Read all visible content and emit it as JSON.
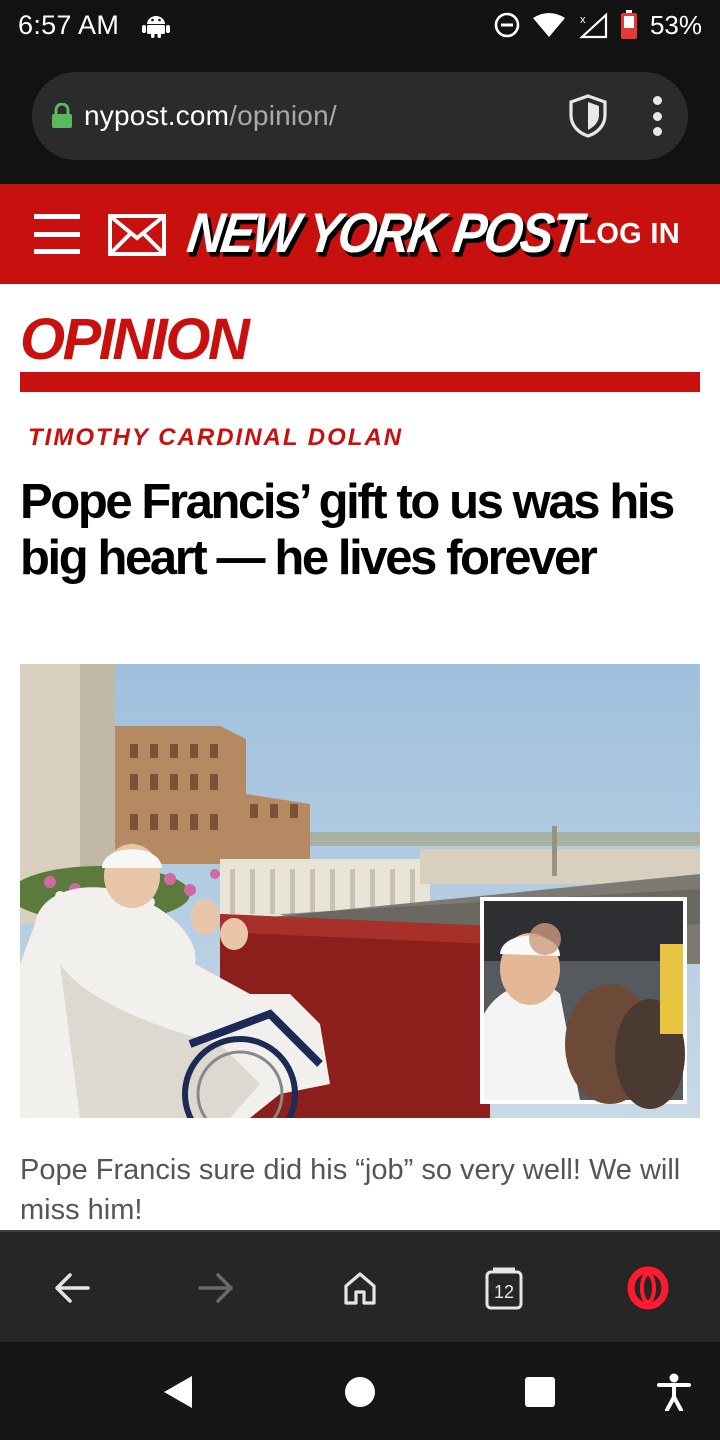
{
  "status_bar": {
    "time": "6:57 AM",
    "battery": "53%",
    "icons": [
      "android-icon",
      "do-not-disturb-icon",
      "wifi-icon",
      "signal-icon",
      "battery-icon"
    ]
  },
  "browser": {
    "url_domain": "nypost.com",
    "url_path": "/opinion/",
    "tab_count": "12"
  },
  "site": {
    "logo_text": "NEW YORK POST",
    "login_label": "LOG IN",
    "brand_color": "#c8100e"
  },
  "article": {
    "section": "OPINION",
    "byline": "TIMOTHY CARDINAL DOLAN",
    "headline": "Pope Francis’ gift to us was his big heart — he lives forever",
    "caption": "Pope Francis sure did his “job” so very well! We will miss him!"
  },
  "nav": {
    "buttons": [
      "back-icon",
      "forward-icon",
      "home-icon",
      "tabs-icon",
      "opera-icon"
    ]
  }
}
